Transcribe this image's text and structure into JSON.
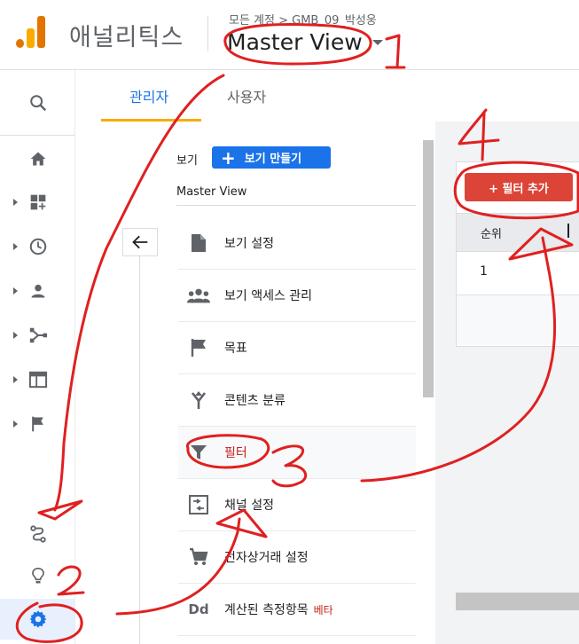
{
  "header": {
    "app_title": "애널리틱스",
    "breadcrumb": "모든 계정 > GMB_09_박성웅",
    "account_name": "Master View",
    "logo_colors": [
      "#f9ab00",
      "#e37400",
      "#f9ab00"
    ]
  },
  "rail": {
    "icons": [
      "search-icon",
      "home-icon",
      "customization-icon",
      "realtime-icon",
      "audience-icon",
      "acquisition-icon",
      "behavior-icon",
      "conversions-icon",
      "attribution-icon",
      "insights-icon",
      "admin-gear-icon"
    ]
  },
  "tabs": [
    {
      "label": "관리자",
      "active": true
    },
    {
      "label": "사용자",
      "active": false
    }
  ],
  "view_panel": {
    "view_label": "보기",
    "create_button": "보기 만들기",
    "selected_view": "Master View",
    "menu_items": [
      {
        "label": "보기 설정",
        "icon": "document-icon"
      },
      {
        "label": "보기 액세스 관리",
        "icon": "people-icon"
      },
      {
        "label": "목표",
        "icon": "flag-icon"
      },
      {
        "label": "콘텐츠 분류",
        "icon": "merge-icon"
      },
      {
        "label": "필터",
        "icon": "filter-icon",
        "active": true
      },
      {
        "label": "채널 설정",
        "icon": "channel-icon"
      },
      {
        "label": "전자상거래 설정",
        "icon": "cart-icon"
      },
      {
        "label": "계산된 측정항목",
        "icon": "dd-icon",
        "badge": "베타"
      }
    ]
  },
  "filter_table": {
    "add_button": "+ 필터 추가",
    "column_header": "순위",
    "rows": [
      "1"
    ]
  },
  "annotations": {
    "numbers": [
      "1",
      "2",
      "3",
      "4"
    ],
    "color": "#e02020"
  },
  "colors": {
    "accent_blue": "#1a73e8",
    "tab_underline": "#f9ab00",
    "active_red": "#c5221f",
    "add_button_red": "#db4437"
  }
}
